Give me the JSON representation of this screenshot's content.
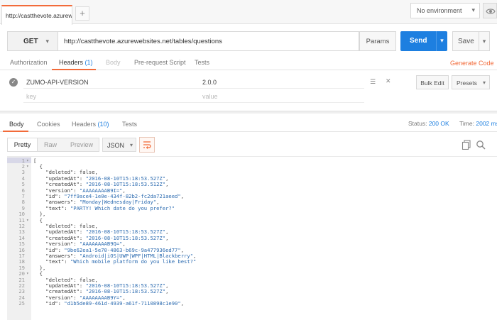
{
  "tabs": {
    "active_title": "http://castthevote.azurewel",
    "add_label": "+"
  },
  "environment": {
    "selected": "No environment"
  },
  "request": {
    "method": "GET",
    "url": "http://castthevote.azurewebsites.net/tables/questions",
    "params_label": "Params",
    "send_label": "Send",
    "save_label": "Save"
  },
  "request_tabs": {
    "authorization": "Authorization",
    "headers": "Headers",
    "headers_count": "(1)",
    "body": "Body",
    "prerequest": "Pre-request Script",
    "tests": "Tests",
    "generate_code": "Generate Code"
  },
  "headers": {
    "rows": [
      {
        "key": "ZUMO-API-VERSION",
        "value": "2.0.0"
      }
    ],
    "key_placeholder": "key",
    "value_placeholder": "value",
    "bulk_edit": "Bulk Edit",
    "presets": "Presets"
  },
  "response_tabs": {
    "body": "Body",
    "cookies": "Cookies",
    "headers": "Headers",
    "headers_count": "(10)",
    "tests": "Tests"
  },
  "response_status": {
    "status_label": "Status:",
    "status_value": "200 OK",
    "time_label": "Time:",
    "time_value": "2002 ms"
  },
  "view_modes": {
    "pretty": "Pretty",
    "raw": "Raw",
    "preview": "Preview",
    "format": "JSON"
  },
  "code_lines": [
    {
      "n": "1",
      "fold": true,
      "text": "["
    },
    {
      "n": "2",
      "fold": true,
      "text": "  {"
    },
    {
      "n": "3",
      "fold": false,
      "text": "    \"deleted\": false,"
    },
    {
      "n": "4",
      "fold": false,
      "text": "    \"updatedAt\": \"2016-08-10T15:18:53.527Z\","
    },
    {
      "n": "5",
      "fold": false,
      "text": "    \"createdAt\": \"2016-08-10T15:18:53.512Z\","
    },
    {
      "n": "6",
      "fold": false,
      "text": "    \"version\": \"AAAAAAAAB9I=\","
    },
    {
      "n": "7",
      "fold": false,
      "text": "    \"id\": \"7ff9ace4-1e0e-434f-82b2-fc2da721aeed\","
    },
    {
      "n": "8",
      "fold": false,
      "text": "    \"answers\": \"Monday|Wednesday|Friday\","
    },
    {
      "n": "9",
      "fold": false,
      "text": "    \"text\": \"PARTY! Which date do you prefer?\""
    },
    {
      "n": "10",
      "fold": false,
      "text": "  },"
    },
    {
      "n": "11",
      "fold": true,
      "text": "  {"
    },
    {
      "n": "12",
      "fold": false,
      "text": "    \"deleted\": false,"
    },
    {
      "n": "13",
      "fold": false,
      "text": "    \"updatedAt\": \"2016-08-10T15:18:53.527Z\","
    },
    {
      "n": "14",
      "fold": false,
      "text": "    \"createdAt\": \"2016-08-10T15:18:53.527Z\","
    },
    {
      "n": "15",
      "fold": false,
      "text": "    \"version\": \"AAAAAAAAB9Q=\","
    },
    {
      "n": "16",
      "fold": false,
      "text": "    \"id\": \"9be62ea1-5e70-4863-b69c-9a477936ed77\","
    },
    {
      "n": "17",
      "fold": false,
      "text": "    \"answers\": \"Android|iOS|UWP|WPF|HTML|Blackberry\","
    },
    {
      "n": "18",
      "fold": false,
      "text": "    \"text\": \"Which mobile platform do you like best?\""
    },
    {
      "n": "19",
      "fold": false,
      "text": "  },"
    },
    {
      "n": "20",
      "fold": true,
      "text": "  {"
    },
    {
      "n": "21",
      "fold": false,
      "text": "    \"deleted\": false,"
    },
    {
      "n": "22",
      "fold": false,
      "text": "    \"updatedAt\": \"2016-08-10T15:18:53.527Z\","
    },
    {
      "n": "23",
      "fold": false,
      "text": "    \"createdAt\": \"2016-08-10T15:18:53.527Z\","
    },
    {
      "n": "24",
      "fold": false,
      "text": "    \"version\": \"AAAAAAAAB9Y=\","
    },
    {
      "n": "25",
      "fold": false,
      "text": "    \"id\": \"d1b5de89-461d-4939-a61f-7110898c1e90\","
    }
  ],
  "colors": {
    "accent": "#f26b3a",
    "primary": "#1d7fe0",
    "string": "#2c6bb0"
  },
  "icons": {
    "chevron": "chevron-down-icon",
    "check": "check-circle-icon",
    "eye": "eye-icon",
    "menu": "drag-handle-icon",
    "close": "close-icon",
    "wrap": "wrap-lines-icon",
    "copy": "copy-icon",
    "search": "search-icon"
  }
}
